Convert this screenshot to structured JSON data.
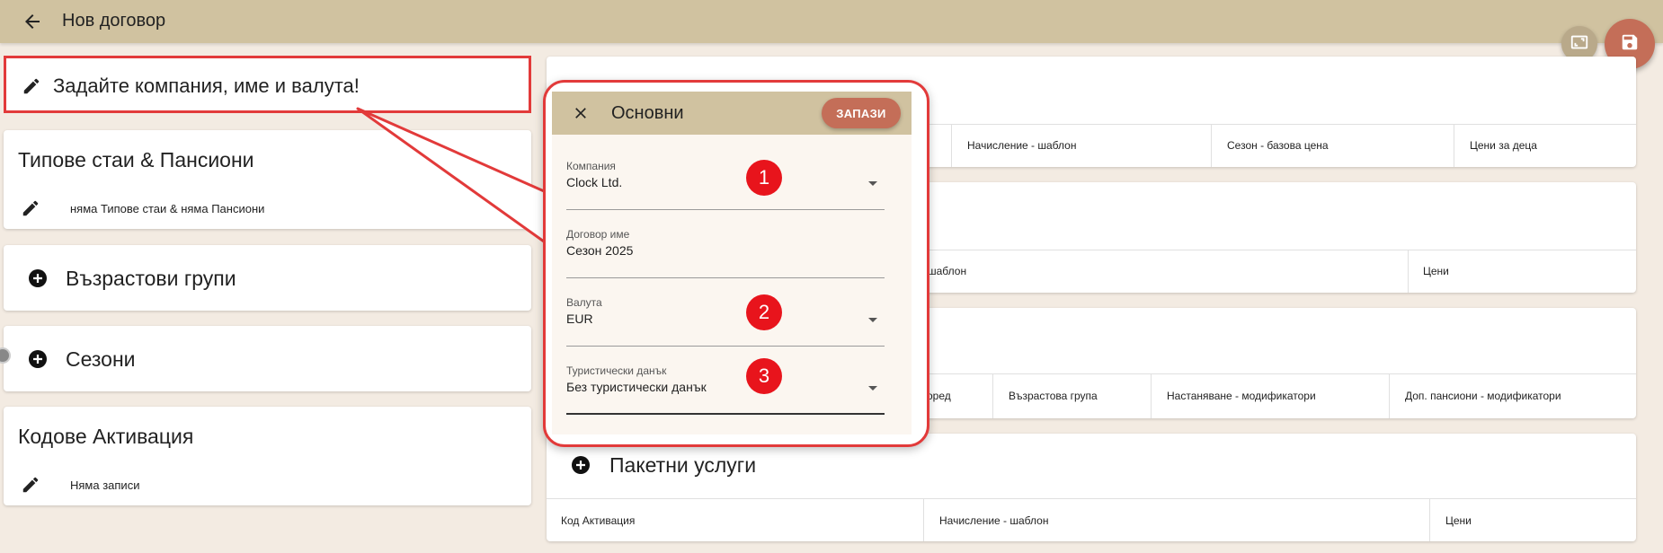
{
  "header": {
    "title": "Нов договор"
  },
  "left": {
    "highlight_text": "Задайте компания, име и валута!",
    "room_types": {
      "title": "Типове стаи & Пансиони",
      "subtitle": "няма Типове стаи & няма Пансиони"
    },
    "age_groups": {
      "title": "Възрастови групи"
    },
    "seasons": {
      "title": "Сезони"
    },
    "activation_codes": {
      "title": "Кодове Активация",
      "subtitle": "Няма записи"
    }
  },
  "right": {
    "card1_cols": [
      "Начисление - шаблон",
      "Сезон - базова цена",
      "Цени за деца"
    ],
    "card2_cols": [
      "шаблон",
      "Цени"
    ],
    "card3_cols": [
      "оред",
      "Възрастова група",
      "Настаняване - модификатори",
      "Доп. пансиони - модификатори"
    ],
    "packages": {
      "title": "Пакетни услуги",
      "cols": [
        "Код Активация",
        "Начисление - шаблон",
        "Цени"
      ]
    }
  },
  "dialog": {
    "title": "Основни",
    "save_label": "ЗАПАЗИ",
    "fields": [
      {
        "label": "Компания",
        "value": "Clock Ltd."
      },
      {
        "label": "Договор име",
        "value": "Сезон 2025"
      },
      {
        "label": "Валута",
        "value": "EUR"
      },
      {
        "label": "Туристически данък",
        "value": "Без туристически данък"
      }
    ],
    "badges": [
      "1",
      "2",
      "3"
    ]
  },
  "colors": {
    "header": "#d0c2a0",
    "accent": "#c46e58",
    "highlight": "#e23a3a",
    "badge": "#e8141c"
  }
}
